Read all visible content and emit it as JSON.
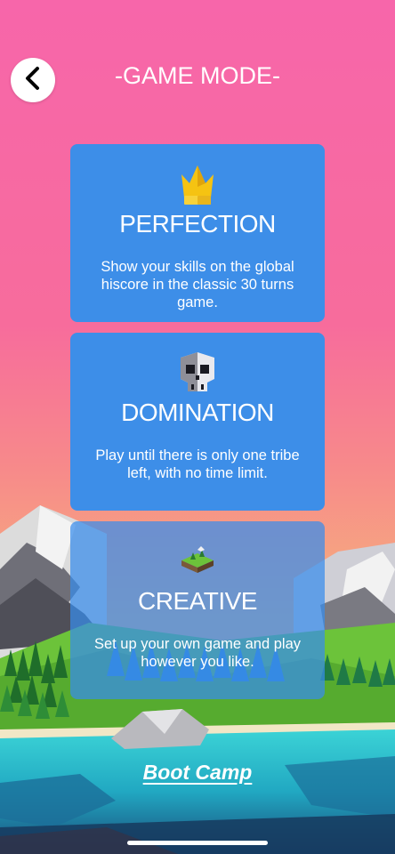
{
  "header": {
    "title": "-GAME MODE-",
    "back_icon": "chevron-left-icon"
  },
  "modes": [
    {
      "name": "PERFECTION",
      "description": "Show your skills on the global hiscore in the classic 30 turns game.",
      "icon": "crown-icon"
    },
    {
      "name": "DOMINATION",
      "description": "Play until there is only one tribe left, with no time limit.",
      "icon": "skull-icon"
    },
    {
      "name": "CREATIVE",
      "description": "Set up your own game and play however you like.",
      "icon": "island-tile-icon"
    }
  ],
  "footer": {
    "link_label": "Boot Camp"
  },
  "colors": {
    "sky_top": "#f766aa",
    "sky_bottom": "#f7aa80",
    "card": "#3d8ee8",
    "text": "#ffffff"
  }
}
